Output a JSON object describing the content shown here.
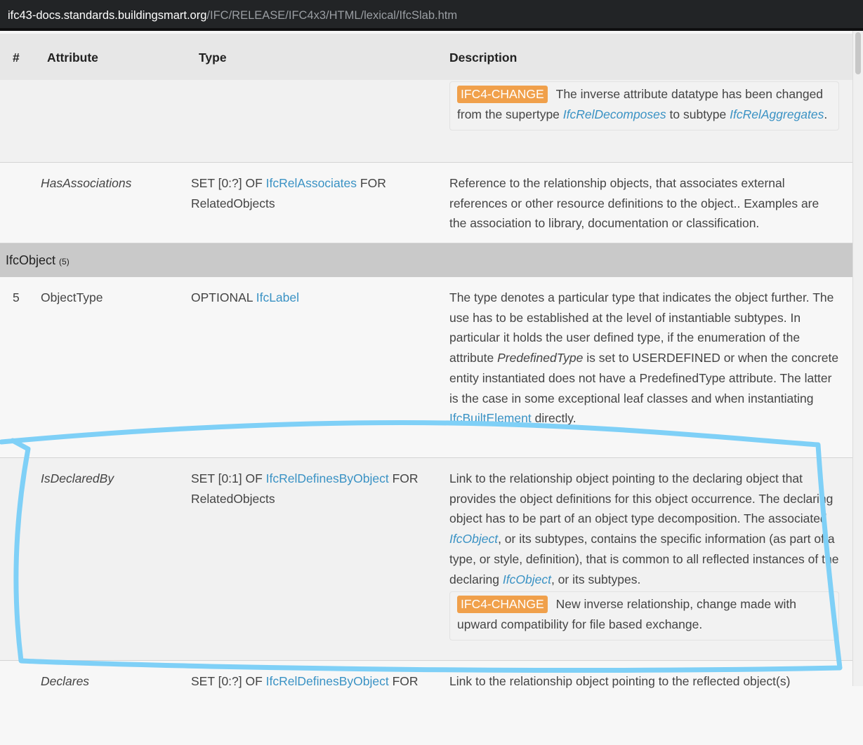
{
  "browser": {
    "url_host": "ifc43-docs.standards.buildingsmart.org",
    "url_path": "/IFC/RELEASE/IFC4x3/HTML/lexical/IfcSlab.htm"
  },
  "table": {
    "headers": {
      "num": "#",
      "attribute": "Attribute",
      "type": "Type",
      "description": "Description"
    },
    "top_note": {
      "badge": "IFC4-CHANGE",
      "text_1": "The inverse attribute datatype has been changed from the supertype ",
      "link_1": "IfcRelDecomposes",
      "text_2": " to subtype ",
      "link_2": "IfcRelAggregates",
      "text_3": "."
    },
    "has_associations": {
      "attribute": "HasAssociations",
      "type_prefix": "SET [0:?] OF ",
      "type_link": "IfcRelAssociates",
      "type_suffix": " FOR RelatedObjects",
      "description": "Reference to the relationship objects, that associates external references or other resource definitions to the object.. Examples are the association to library, documentation or classification."
    },
    "group": {
      "title": "IfcObject",
      "count": "(5)"
    },
    "object_type": {
      "num": "5",
      "attribute": "ObjectType",
      "type_prefix": "OPTIONAL ",
      "type_link": "IfcLabel",
      "desc_1": "The type denotes a particular type that indicates the object further. The use has to be established at the level of instantiable subtypes. In particular it holds the user defined type, if the enumeration of the attribute ",
      "desc_em": "PredefinedType",
      "desc_2": " is set to USERDEFINED or when the concrete entity instantiated does not have a PredefinedType attribute. The latter is the case in some exceptional leaf classes and when instantiating ",
      "desc_link": "IfcBuiltElement",
      "desc_3": " directly."
    },
    "is_declared_by": {
      "attribute": "IsDeclaredBy",
      "type_prefix": "SET [0:1] OF ",
      "type_link": "IfcRelDefinesByObject",
      "type_suffix": " FOR RelatedObjects",
      "desc_1": "Link to the relationship object pointing to the declaring object that provides the object definitions for this object occurrence. The declaring object has to be part of an object type decomposition. The associated ",
      "desc_link_1": "IfcObject",
      "desc_2": ", or its subtypes, contains the specific information (as part of a type, or style, definition), that is common to all reflected instances of the declaring ",
      "desc_link_2": "IfcObject",
      "desc_3": ", or its subtypes.",
      "note_badge": "IFC4-CHANGE",
      "note_text": "New inverse relationship, change made with upward compatibility for file based exchange."
    },
    "declares": {
      "attribute": "Declares",
      "type_prefix": "SET [0:?] OF ",
      "type_link": "IfcRelDefinesByObject",
      "type_suffix": " FOR",
      "description": "Link to the relationship object pointing to the reflected object(s)"
    }
  },
  "annotation": {
    "color": "#7fd0f7"
  }
}
